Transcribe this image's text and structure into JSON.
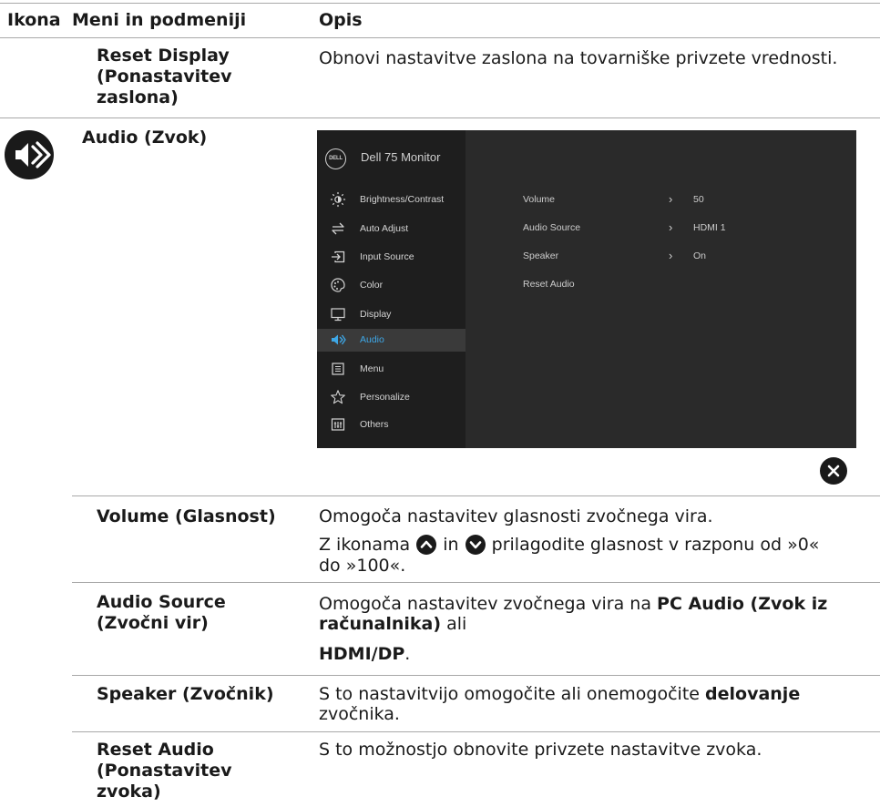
{
  "header": {
    "col_icon": "Ikona",
    "col_menu": "Meni in podmeniji",
    "col_desc": "Opis"
  },
  "reset_display": {
    "name_line1": "Reset Display",
    "name_line2": "(Ponastavitev",
    "name_line3": "zaslona)",
    "desc": "Obnovi nastavitve zaslona na tovarniške privzete vrednosti."
  },
  "audio": {
    "name": "Audio (Zvok)",
    "icon": "speaker-icon"
  },
  "osd": {
    "title": "Dell 75 Monitor",
    "logo": "DELL",
    "menu": [
      {
        "label": "Brightness/Contrast",
        "icon": "brightness-icon"
      },
      {
        "label": "Auto Adjust",
        "icon": "auto-adjust-icon"
      },
      {
        "label": "Input Source",
        "icon": "input-source-icon"
      },
      {
        "label": "Color",
        "icon": "color-icon"
      },
      {
        "label": "Display",
        "icon": "display-icon"
      },
      {
        "label": "Audio",
        "icon": "audio-icon",
        "selected": true
      },
      {
        "label": "Menu",
        "icon": "menu-icon"
      },
      {
        "label": "Personalize",
        "icon": "star-icon"
      },
      {
        "label": "Others",
        "icon": "others-icon"
      }
    ],
    "settings": [
      {
        "label": "Volume",
        "value": "50"
      },
      {
        "label": "Audio Source",
        "value": "HDMI 1"
      },
      {
        "label": "Speaker",
        "value": "On"
      },
      {
        "label": "Reset Audio",
        "value": ""
      }
    ],
    "selected_color": "#3ea7e6"
  },
  "volume": {
    "name": "Volume (Glasnost)",
    "desc1": "Omogoča nastavitev glasnosti zvočnega vira.",
    "desc2_a": "Z ikonama",
    "desc2_in": "in",
    "desc2_b": "prilagodite glasnost v razponu od »0«",
    "desc2_c": "do »100«."
  },
  "audio_source": {
    "name_line1": "Audio Source",
    "name_line2": "(Zvočni vir)",
    "desc_a": "Omogoča nastavitev zvočnega vira na",
    "desc_bold1": "PC Audio (Zvok iz",
    "desc_bold2": "računalnika)",
    "desc_b": "ali",
    "desc_bold3": "HDMI/DP",
    "desc_dot": "."
  },
  "speaker": {
    "name": "Speaker (Zvočnik)",
    "desc_a": "S to nastavitvijo omogočite ali onemogočite",
    "desc_bold": "delovanje",
    "desc_b": "zvočnika."
  },
  "reset_audio": {
    "name_line1": "Reset Audio",
    "name_line2": "(Ponastavitev",
    "name_line3": "zvoka)",
    "desc": "S to možnostjo obnovite privzete nastavitve zvoka."
  }
}
